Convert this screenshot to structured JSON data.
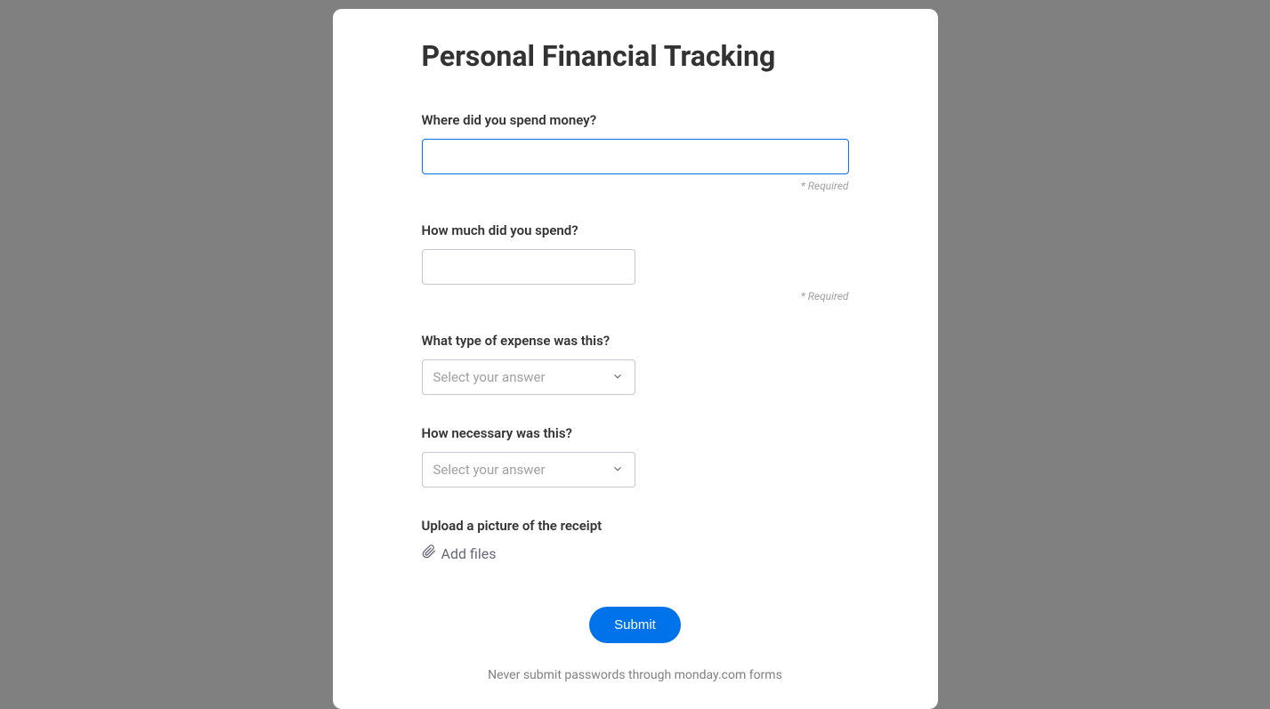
{
  "form": {
    "title": "Personal Financial Tracking",
    "fields": {
      "where": {
        "label": "Where did you spend money?",
        "value": "",
        "required_text": "* Required"
      },
      "amount": {
        "label": "How much did you spend?",
        "value": "",
        "required_text": "* Required"
      },
      "type": {
        "label": "What type of expense was this?",
        "placeholder": "Select your answer"
      },
      "necessity": {
        "label": "How necessary was this?",
        "placeholder": "Select your answer"
      },
      "upload": {
        "label": "Upload a picture of the receipt",
        "add_files_label": "Add files"
      }
    },
    "submit_label": "Submit",
    "disclaimer": "Never submit passwords through monday.com forms"
  }
}
